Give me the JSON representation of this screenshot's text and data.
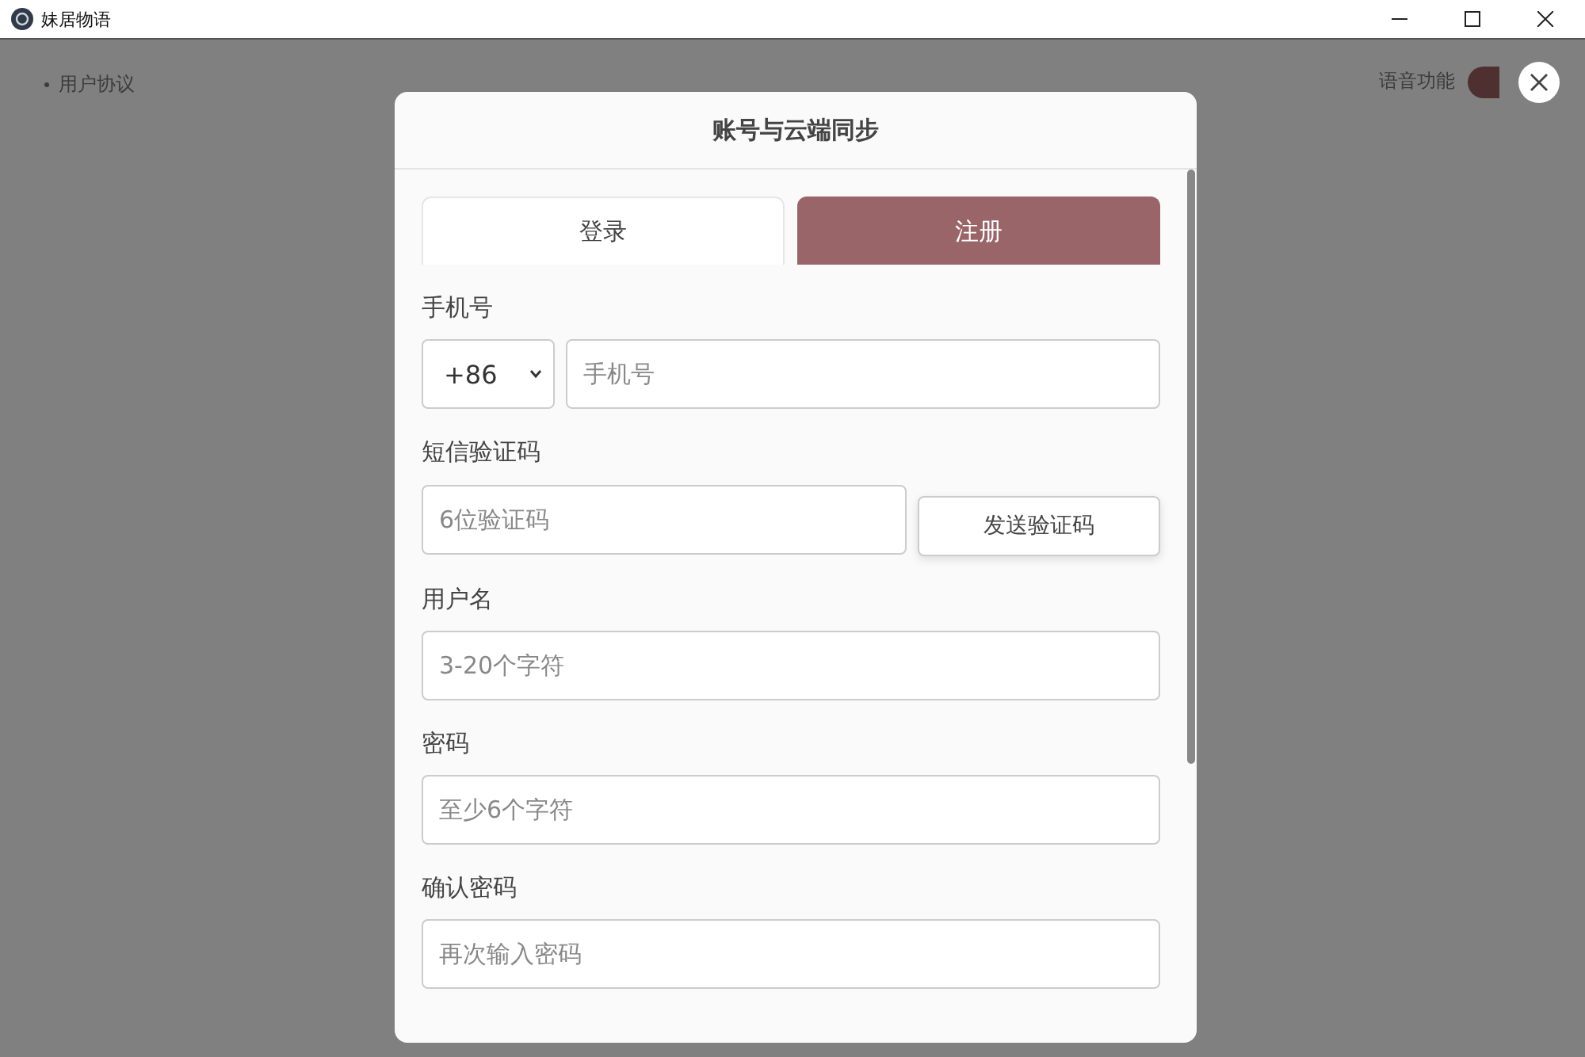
{
  "window": {
    "title": "妹居物语"
  },
  "page": {
    "links": [
      "用户协议"
    ],
    "voice": {
      "label": "语音功能",
      "on": true
    }
  },
  "dialog": {
    "title": "账号与云端同步",
    "tabs": [
      {
        "label": "登录",
        "selected": false
      },
      {
        "label": "注册",
        "selected": true
      }
    ],
    "fields": [
      {
        "kind": "phone",
        "label": "手机号",
        "country": "+86",
        "placeholder": "手机号"
      },
      {
        "kind": "code",
        "label": "短信验证码",
        "placeholder": "6位验证码",
        "button": "发送验证码"
      },
      {
        "kind": "text",
        "label": "用户名",
        "placeholder": "3-20个字符"
      },
      {
        "kind": "text",
        "label": "密码",
        "placeholder": "至少6个字符"
      },
      {
        "kind": "text",
        "label": "确认密码",
        "placeholder": "再次输入密码"
      }
    ]
  }
}
